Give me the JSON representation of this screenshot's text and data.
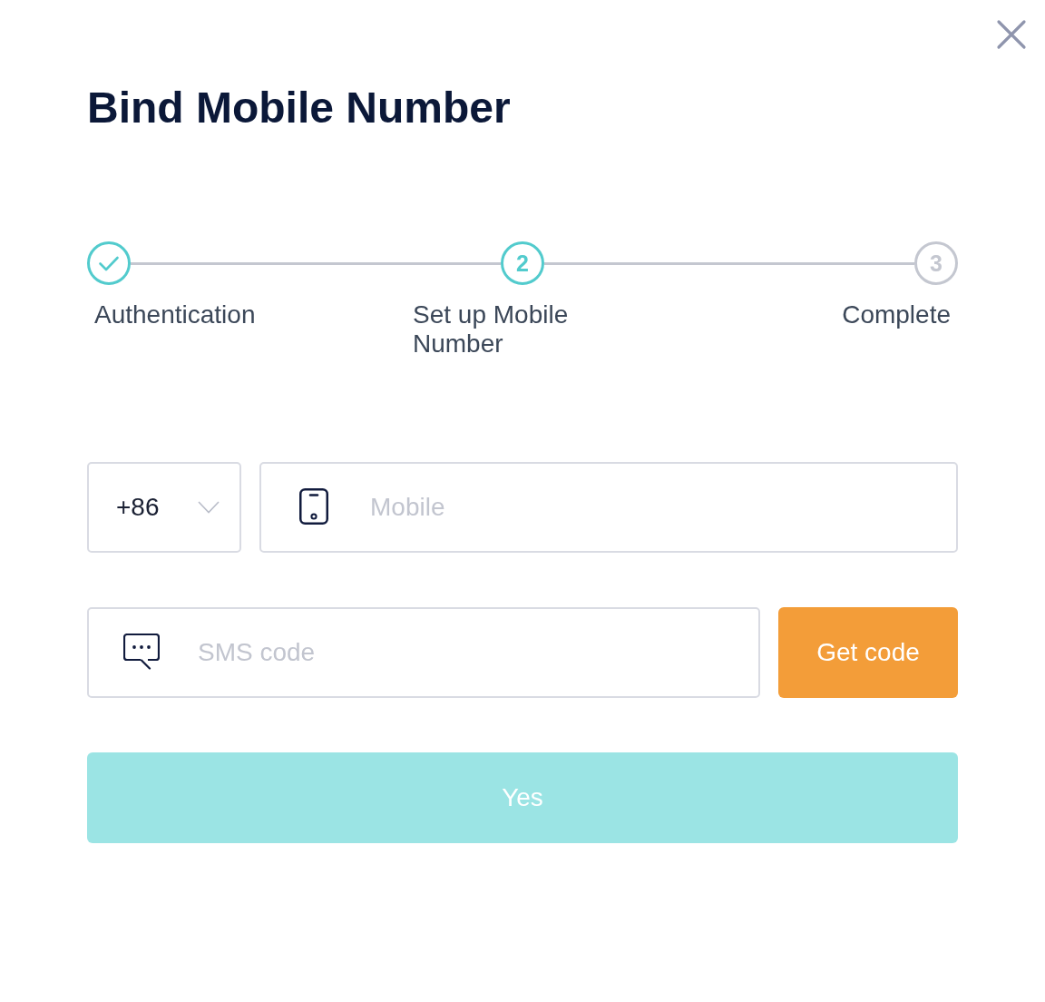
{
  "dialog": {
    "title": "Bind Mobile Number"
  },
  "steps": [
    {
      "label": "Authentication",
      "completed": true,
      "selected": false
    },
    {
      "number": "2",
      "label": "Set up Mobile Number",
      "completed": false,
      "selected": true
    },
    {
      "number": "3",
      "label": "Complete",
      "completed": false,
      "selected": false
    }
  ],
  "form": {
    "country_code": {
      "value": "+86"
    },
    "mobile": {
      "placeholder": "Mobile"
    },
    "sms_code": {
      "placeholder": "SMS code"
    },
    "get_code_button": "Get code",
    "submit_button": {
      "label": "Yes",
      "disabled": true
    }
  }
}
